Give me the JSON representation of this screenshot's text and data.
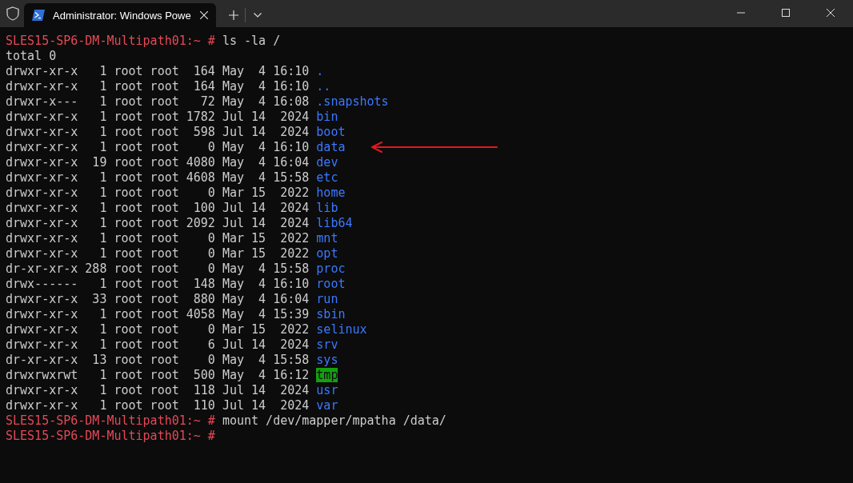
{
  "window": {
    "tab_title": "Administrator: Windows Powe"
  },
  "terminal": {
    "lines": [
      {
        "kind": "prompt",
        "prompt": "SLES15-SP6-DM-Multipath01:~ #",
        "command": "ls -la /"
      },
      {
        "kind": "text",
        "text": "total 0"
      },
      {
        "kind": "entry",
        "meta": "drwxr-xr-x   1 root root  164 May  4 16:10",
        "name": ".",
        "highlighted": false
      },
      {
        "kind": "entry",
        "meta": "drwxr-xr-x   1 root root  164 May  4 16:10",
        "name": "..",
        "highlighted": false
      },
      {
        "kind": "entry",
        "meta": "drwxr-x---   1 root root   72 May  4 16:08",
        "name": ".snapshots",
        "highlighted": false
      },
      {
        "kind": "entry",
        "meta": "drwxr-xr-x   1 root root 1782 Jul 14  2024",
        "name": "bin",
        "highlighted": false
      },
      {
        "kind": "entry",
        "meta": "drwxr-xr-x   1 root root  598 Jul 14  2024",
        "name": "boot",
        "highlighted": false
      },
      {
        "kind": "entry",
        "meta": "drwxr-xr-x   1 root root    0 May  4 16:10",
        "name": "data",
        "highlighted": false,
        "marked": true
      },
      {
        "kind": "entry",
        "meta": "drwxr-xr-x  19 root root 4080 May  4 16:04",
        "name": "dev",
        "highlighted": false
      },
      {
        "kind": "entry",
        "meta": "drwxr-xr-x   1 root root 4608 May  4 15:58",
        "name": "etc",
        "highlighted": false
      },
      {
        "kind": "entry",
        "meta": "drwxr-xr-x   1 root root    0 Mar 15  2022",
        "name": "home",
        "highlighted": false
      },
      {
        "kind": "entry",
        "meta": "drwxr-xr-x   1 root root  100 Jul 14  2024",
        "name": "lib",
        "highlighted": false
      },
      {
        "kind": "entry",
        "meta": "drwxr-xr-x   1 root root 2092 Jul 14  2024",
        "name": "lib64",
        "highlighted": false
      },
      {
        "kind": "entry",
        "meta": "drwxr-xr-x   1 root root    0 Mar 15  2022",
        "name": "mnt",
        "highlighted": false
      },
      {
        "kind": "entry",
        "meta": "drwxr-xr-x   1 root root    0 Mar 15  2022",
        "name": "opt",
        "highlighted": false
      },
      {
        "kind": "entry",
        "meta": "dr-xr-xr-x 288 root root    0 May  4 15:58",
        "name": "proc",
        "highlighted": false
      },
      {
        "kind": "entry",
        "meta": "drwx------   1 root root  148 May  4 16:10",
        "name": "root",
        "highlighted": false
      },
      {
        "kind": "entry",
        "meta": "drwxr-xr-x  33 root root  880 May  4 16:04",
        "name": "run",
        "highlighted": false
      },
      {
        "kind": "entry",
        "meta": "drwxr-xr-x   1 root root 4058 May  4 15:39",
        "name": "sbin",
        "highlighted": false
      },
      {
        "kind": "entry",
        "meta": "drwxr-xr-x   1 root root    0 Mar 15  2022",
        "name": "selinux",
        "highlighted": false
      },
      {
        "kind": "entry",
        "meta": "drwxr-xr-x   1 root root    6 Jul 14  2024",
        "name": "srv",
        "highlighted": false
      },
      {
        "kind": "entry",
        "meta": "dr-xr-xr-x  13 root root    0 May  4 15:58",
        "name": "sys",
        "highlighted": false
      },
      {
        "kind": "entry",
        "meta": "drwxrwxrwt   1 root root  500 May  4 16:12",
        "name": "tmp",
        "highlighted": true
      },
      {
        "kind": "entry",
        "meta": "drwxr-xr-x   1 root root  118 Jul 14  2024",
        "name": "usr",
        "highlighted": false
      },
      {
        "kind": "entry",
        "meta": "drwxr-xr-x   1 root root  110 Jul 14  2024",
        "name": "var",
        "highlighted": false
      },
      {
        "kind": "prompt",
        "prompt": "SLES15-SP6-DM-Multipath01:~ #",
        "command": "mount /dev/mapper/mpatha /data/"
      },
      {
        "kind": "prompt",
        "prompt": "SLES15-SP6-DM-Multipath01:~ #"
      }
    ]
  }
}
